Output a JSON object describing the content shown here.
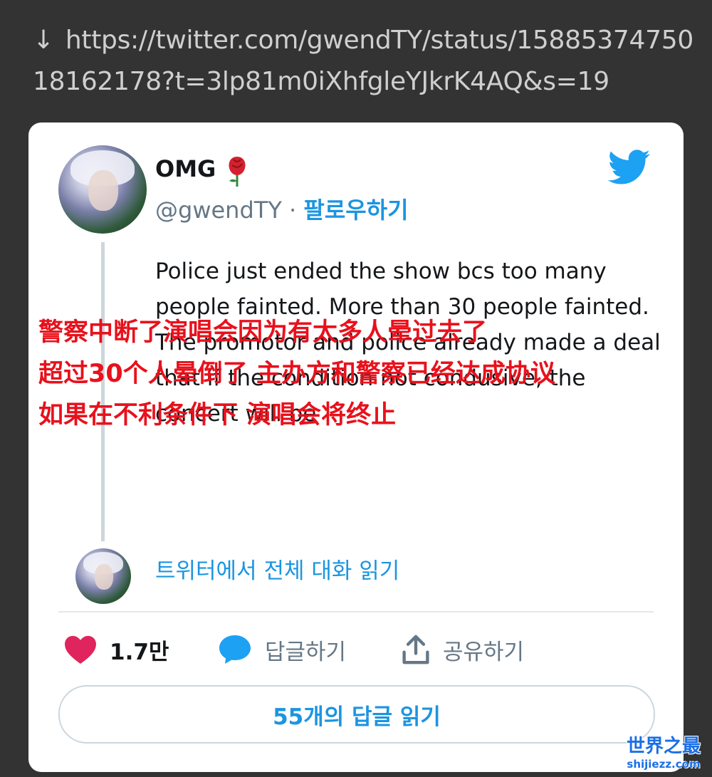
{
  "url": {
    "arrow": "↓",
    "text": "https://twitter.com/gwendTY/status/1588537475018162178?t=3lp81m0iXhfgleYJkrK4AQ&s=19"
  },
  "tweet": {
    "author_name": "OMG",
    "name_emoji": "rose",
    "handle": "@gwendTY",
    "separator": "·",
    "follow_label": "팔로우하기",
    "text": "Police just ended the show bcs too many people fainted. More than 30 people fainted. The promotor and police already made a deal that if the condition not condusive, the concert will be",
    "read_conversation": "트위터에서 전체 대화 읽기",
    "brand_icon": "twitter-bird-icon",
    "brand_color": "#1da1f2"
  },
  "overlay_caption": {
    "lines": [
      "警察中断了演唱会因为有太多人晕过去了",
      "超过30个人晕倒了 主办方和警察已经达成协议",
      "如果在不利条件下 演唱会将终止"
    ],
    "color": "#e8111c"
  },
  "actions": {
    "like_count": "1.7만",
    "reply_label": "답글하기",
    "share_label": "공유하기",
    "like_color": "#e0245e",
    "reply_color": "#1da1f2"
  },
  "replies_button": {
    "label": "55개의 답글 읽기"
  },
  "watermark": {
    "main": "世界之最",
    "sub": "shijiezz.com"
  }
}
